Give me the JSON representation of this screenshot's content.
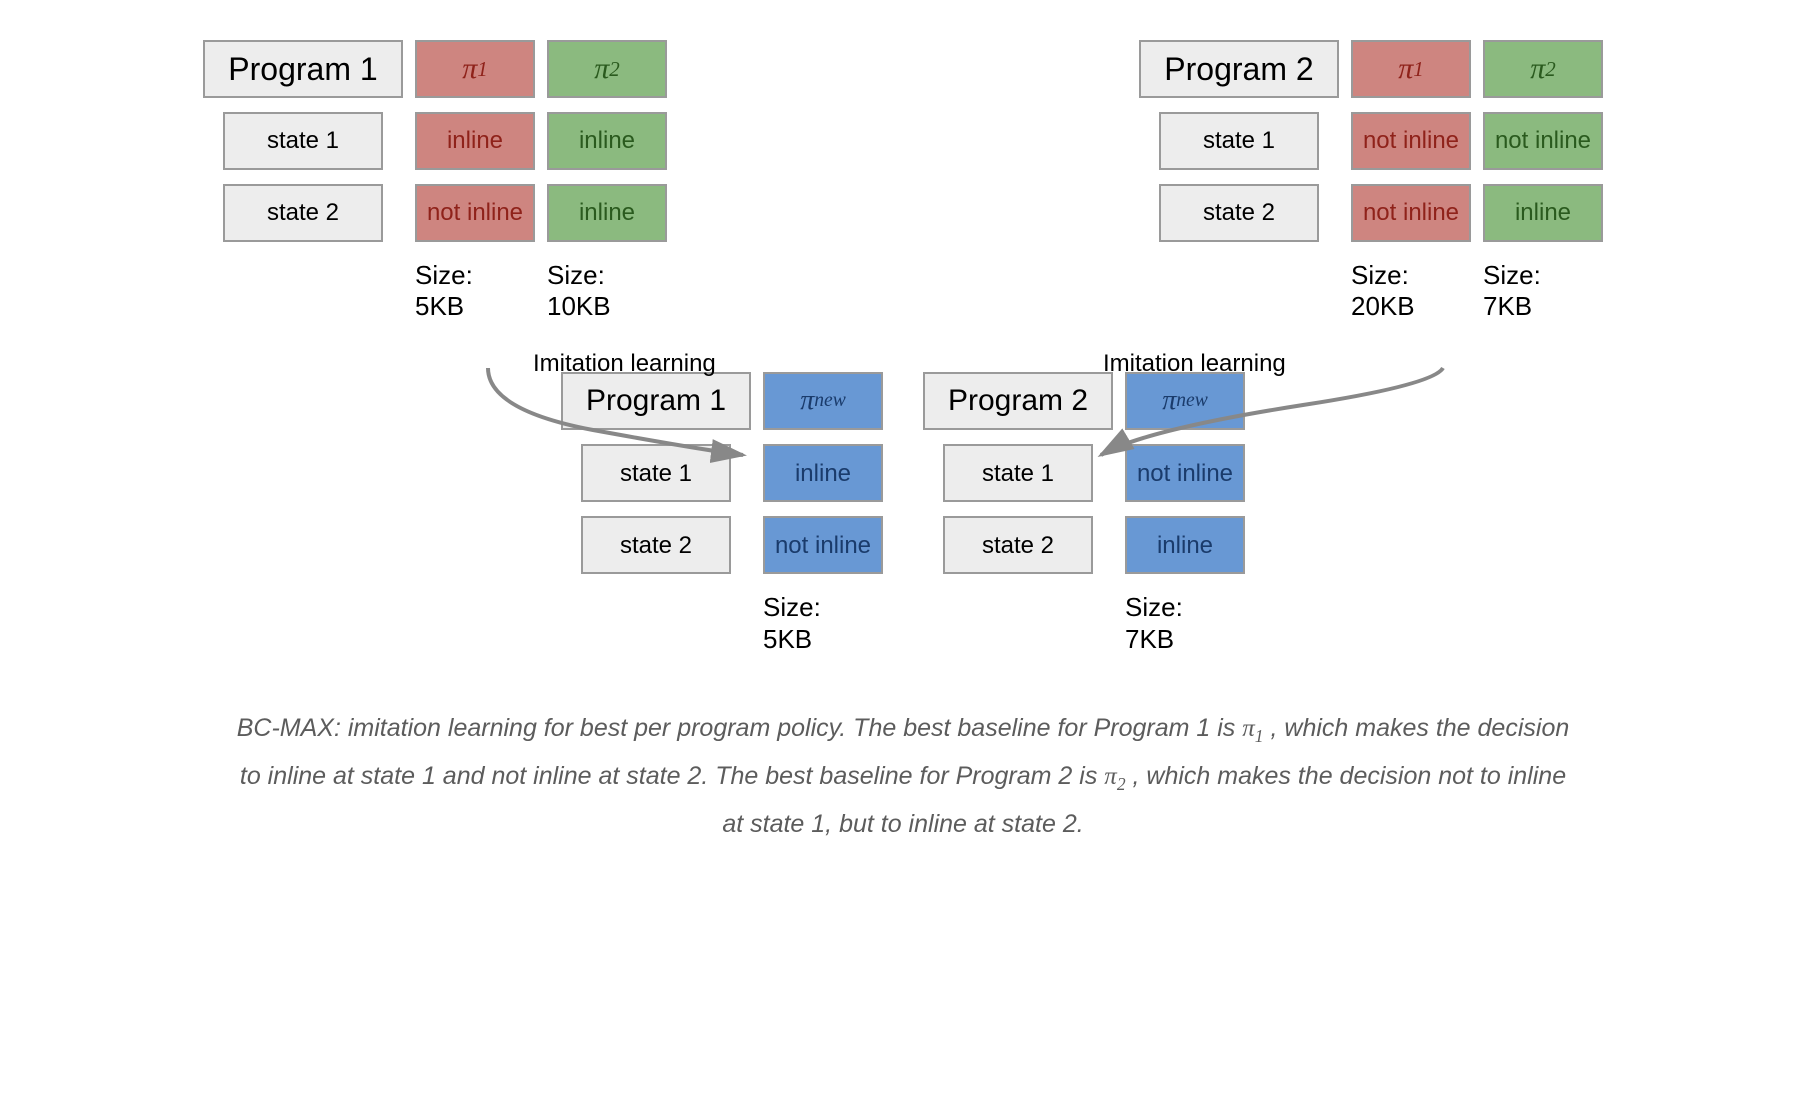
{
  "top": {
    "left": {
      "title": "Program 1",
      "states": [
        "state 1",
        "state 2"
      ],
      "pi1": {
        "label": "π",
        "sub": "1",
        "values": [
          "inline",
          "not inline"
        ],
        "size_label": "Size:",
        "size_value": "5KB"
      },
      "pi2": {
        "label": "π",
        "sub": "2",
        "values": [
          "inline",
          "inline"
        ],
        "size_label": "Size:",
        "size_value": "10KB"
      },
      "imitation_label": "Imitation learning"
    },
    "right": {
      "title": "Program 2",
      "states": [
        "state 1",
        "state 2"
      ],
      "pi1": {
        "label": "π",
        "sub": "1",
        "values": [
          "not inline",
          "not inline"
        ],
        "size_label": "Size:",
        "size_value": "20KB"
      },
      "pi2": {
        "label": "π",
        "sub": "2",
        "values": [
          "not inline",
          "inline"
        ],
        "size_label": "Size:",
        "size_value": "7KB"
      },
      "imitation_label": "Imitation learning"
    }
  },
  "bottom": {
    "left": {
      "title": "Program 1",
      "states": [
        "state 1",
        "state 2"
      ],
      "pi_new": {
        "label": "π",
        "sub": "new",
        "values": [
          "inline",
          "not inline"
        ],
        "size_label": "Size:",
        "size_value": "5KB"
      }
    },
    "right": {
      "title": "Program 2",
      "states": [
        "state 1",
        "state 2"
      ],
      "pi_new": {
        "label": "π",
        "sub": "new",
        "values": [
          "not inline",
          "inline"
        ],
        "size_label": "Size:",
        "size_value": "7KB"
      }
    }
  },
  "caption": {
    "p1": "BC-MAX: imitation learning for best per program policy. The best baseline for Program 1 is ",
    "pi1": "π",
    "pi1sub": "1",
    "p2": " , which makes the decision to inline at state 1 and not inline at state 2. The best baseline for Program 2 is ",
    "pi2": "π",
    "pi2sub": "2",
    "p3": " , which makes the decision not to inline at state 1, but to inline at state 2."
  }
}
